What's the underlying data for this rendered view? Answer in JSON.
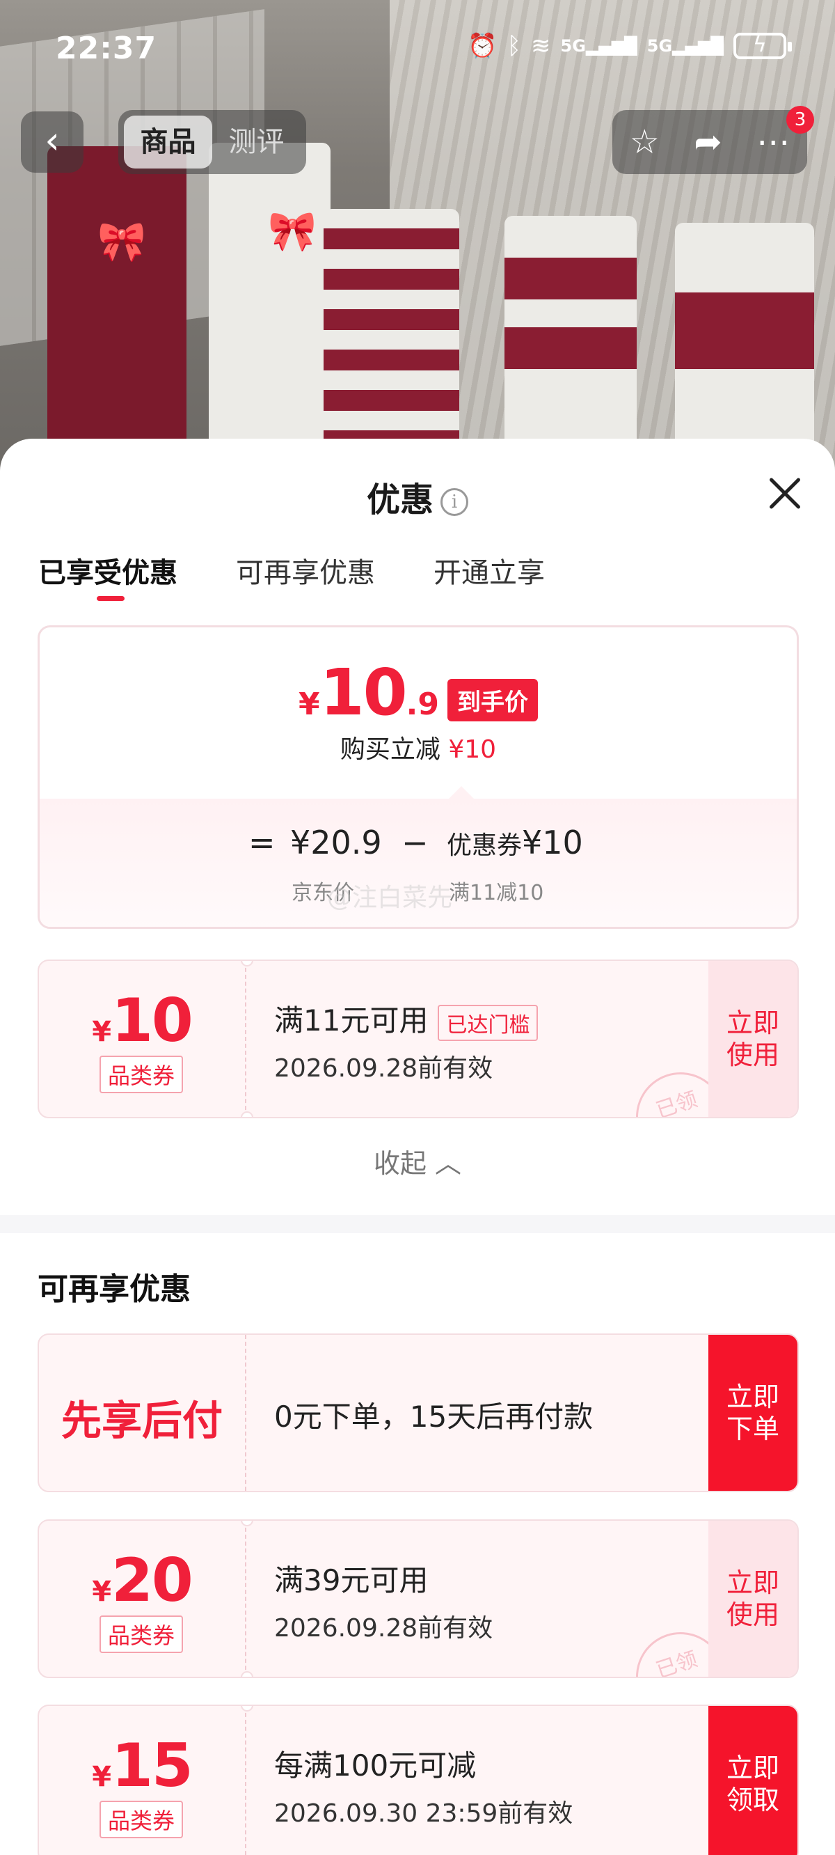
{
  "status": {
    "time": "22:37",
    "net1": "5G",
    "net2": "5G"
  },
  "nav": {
    "back_icon": "chevron-left-icon",
    "tab_product": "商品",
    "tab_review": "测评",
    "cart_badge": "3"
  },
  "sheet": {
    "title": "优惠",
    "close_icon": "close-icon"
  },
  "tabs": [
    "已享受优惠",
    "可再享优惠",
    "开通立享"
  ],
  "price_box": {
    "symbol": "¥",
    "integer": "10",
    "decimal": ".9",
    "tag": "到手价",
    "reduce_label": "购买立减",
    "reduce_value": "¥10",
    "eq": "=",
    "jd_price": "¥20.9",
    "minus": "−",
    "coupon_label": "优惠券",
    "coupon_value": "¥10",
    "jd_label": "京东价",
    "coupon_rule": "满11减10"
  },
  "watermark": "@注白菜先",
  "coupon_enjoyed": {
    "symbol": "¥",
    "amount": "10",
    "category": "品类券",
    "condition": "满11元可用",
    "reached": "已达门槛",
    "valid": "2026.09.28前有效",
    "action": "立即使用",
    "claimed": "已领"
  },
  "collapse": "收起",
  "section_more": "可再享优惠",
  "pay_later": {
    "title": "先享后付",
    "desc": "0元下单，15天后再付款",
    "action": "立即下单"
  },
  "coupon_20": {
    "symbol": "¥",
    "amount": "20",
    "category": "品类券",
    "condition": "满39元可用",
    "valid": "2026.09.28前有效",
    "action": "立即使用",
    "claimed": "已领"
  },
  "coupon_15": {
    "symbol": "¥",
    "amount": "15",
    "category": "品类券",
    "condition": "每满100元可减",
    "valid": "2026.09.30 23:59前有效",
    "action": "立即领取"
  },
  "colors": {
    "accent": "#f0203a",
    "action_solid": "#f5142b",
    "coupon_bg": "#fff5f6"
  }
}
